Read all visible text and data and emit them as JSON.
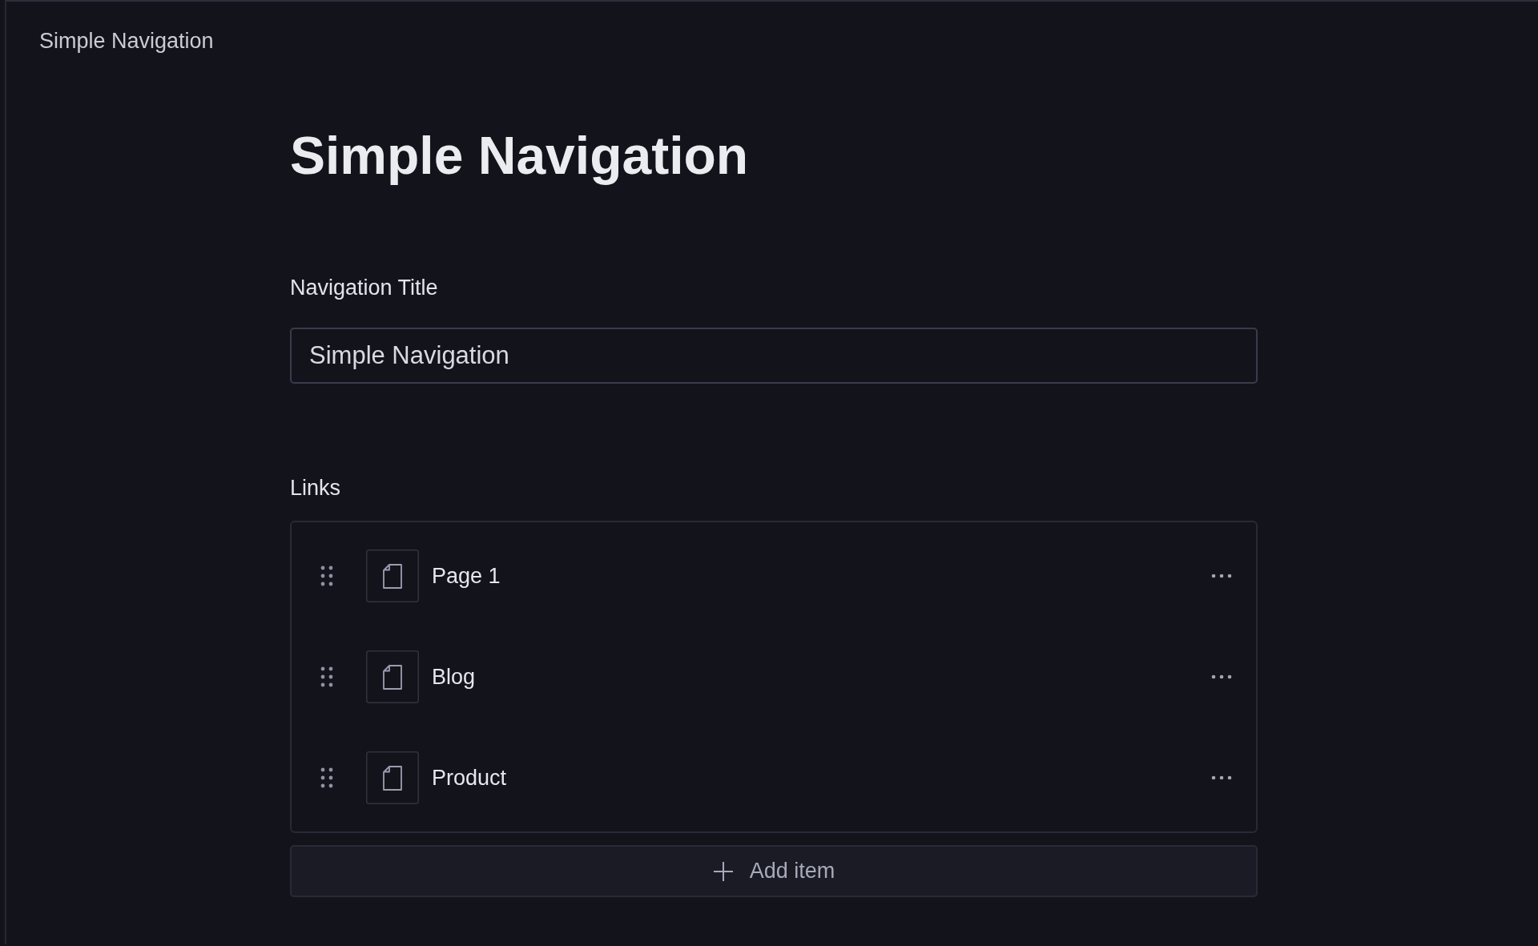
{
  "breadcrumb": "Simple Navigation",
  "title": "Simple Navigation",
  "title_field": {
    "label": "Navigation Title",
    "value": "Simple Navigation"
  },
  "links": {
    "label": "Links",
    "items": [
      {
        "label": "Page 1"
      },
      {
        "label": "Blog"
      },
      {
        "label": "Product"
      }
    ],
    "add_button": "Add item"
  }
}
